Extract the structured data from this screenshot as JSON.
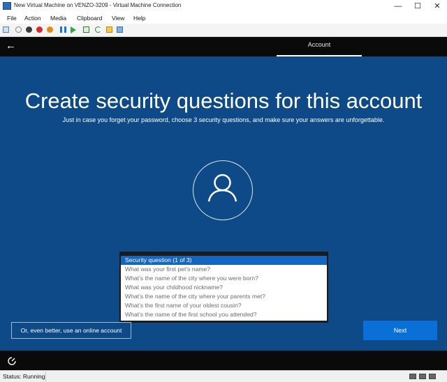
{
  "window": {
    "title": "New Virtual Machine on VENZO-3209 - Virtual Machine Connection",
    "minimize_glyph": "—",
    "maximize_glyph": "☐",
    "close_glyph": "✕"
  },
  "menu": {
    "file": "File",
    "action": "Action",
    "media": "Media",
    "clipboard": "Clipboard",
    "view": "View",
    "help": "Help"
  },
  "toolbar": {
    "icons": [
      "ctrl-alt-del-icon",
      "start-icon",
      "turn-off-icon",
      "shutdown-icon",
      "save-state-icon",
      "pause-icon",
      "resume-icon",
      "checkpoint-icon",
      "revert-icon",
      "enhanced-session-icon"
    ]
  },
  "oobe": {
    "back_glyph": "←",
    "tab_label": "Account",
    "heading": "Create security questions for this account",
    "subtitle": "Just in case you forget your password, choose 3 security questions, and make sure your answers are unforgettable.",
    "dropdown": {
      "selected": "Security question (1 of 3)",
      "options": [
        "What was your first pet’s name?",
        "What’s the name of the city where you were born?",
        "What was your childhood nickname?",
        "What’s the name of the city where your parents met?",
        "What’s the first name of your oldest cousin?",
        "What’s the name of the first school you attended?"
      ]
    },
    "online_account_button": "Or, even better, use an online account",
    "next_button": "Next"
  },
  "status": {
    "text": "Status: Running"
  },
  "colors": {
    "oobe_background": "#0d4a87",
    "accent": "#0a6fd6",
    "selection": "#1566c0"
  }
}
